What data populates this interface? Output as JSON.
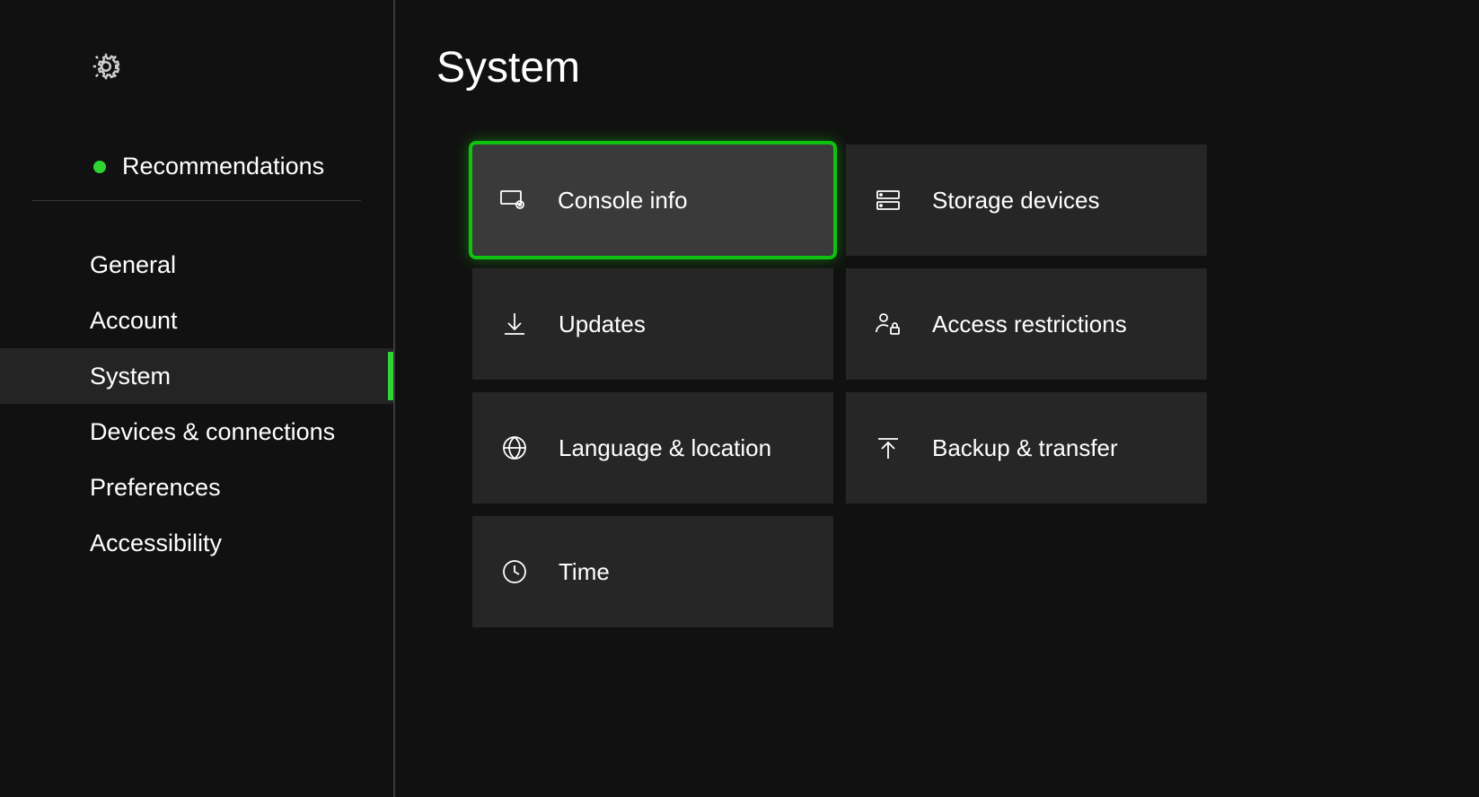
{
  "sidebar": {
    "recommendations_label": "Recommendations",
    "items": [
      {
        "label": "General"
      },
      {
        "label": "Account"
      },
      {
        "label": "System"
      },
      {
        "label": "Devices & connections"
      },
      {
        "label": "Preferences"
      },
      {
        "label": "Accessibility"
      }
    ],
    "active_index": 2
  },
  "main": {
    "title": "System",
    "tiles": [
      {
        "label": "Console info",
        "selected": true
      },
      {
        "label": "Storage devices"
      },
      {
        "label": "Updates"
      },
      {
        "label": "Access restrictions"
      },
      {
        "label": "Language & location"
      },
      {
        "label": "Backup & transfer"
      },
      {
        "label": "Time"
      }
    ]
  }
}
